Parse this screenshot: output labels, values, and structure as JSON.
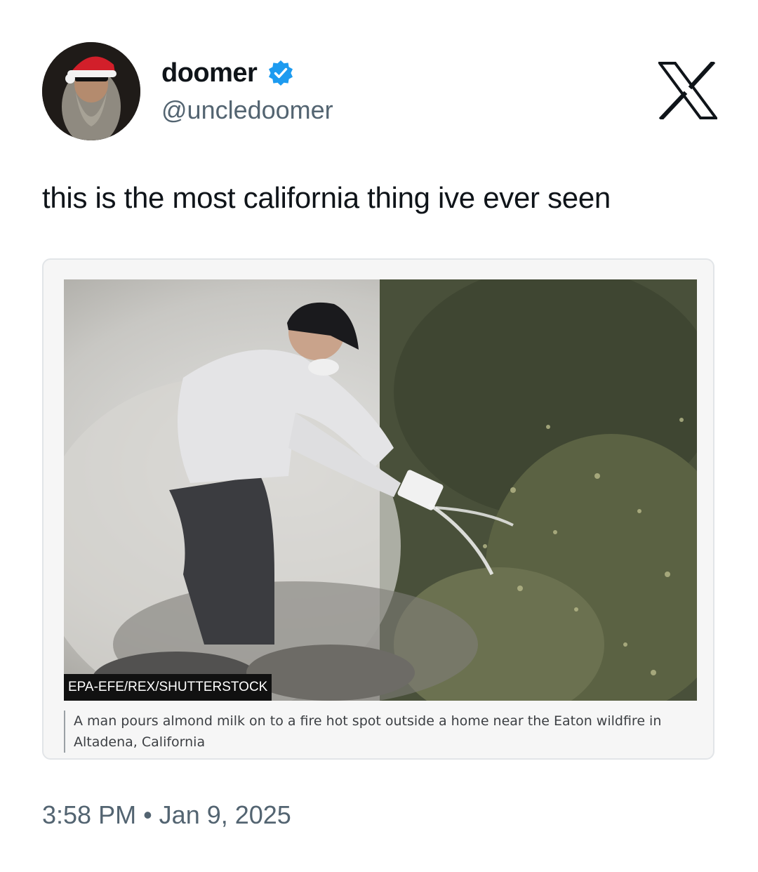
{
  "author": {
    "display_name": "doomer",
    "handle": "@uncledoomer",
    "verified": true,
    "avatar_icon": "avatar-bearded-man-santa-hat"
  },
  "brand_icon": "x-logo-icon",
  "tweet": {
    "text": "this is the most california thing ive ever seen",
    "timestamp": "3:58 PM • Jan 9, 2025"
  },
  "embed": {
    "photo_description_icon": "photo-man-pouring-milk-on-smoking-bushes",
    "photo_credit": "EPA-EFE/REX/SHUTTERSTOCK",
    "caption": "A man pours almond milk on to a fire hot spot outside a home near the Eaton wildfire in Altadena, California"
  },
  "colors": {
    "verified_blue": "#1d9bf0",
    "secondary_text": "#536471",
    "primary_text": "#0f1419"
  }
}
